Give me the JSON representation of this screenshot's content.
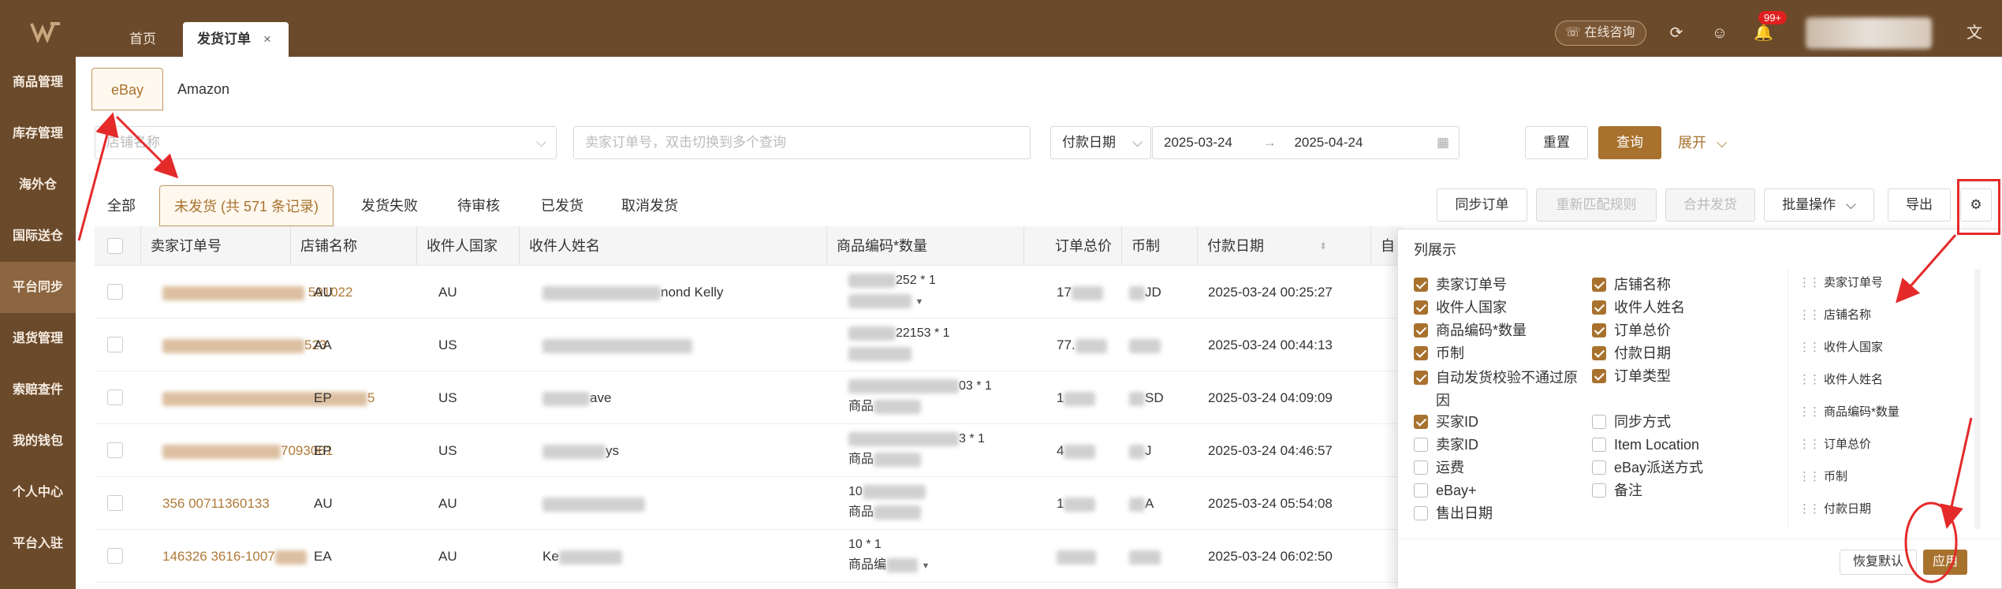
{
  "topbar": {
    "tabs": [
      {
        "label": "首页",
        "active": false
      },
      {
        "label": "发货订单",
        "active": true,
        "close": "×"
      }
    ],
    "consult_label": "在线咨询",
    "notification_count": "99+",
    "accent_color": "#6b4a2b"
  },
  "sidebar": {
    "items": [
      {
        "label": "商品管理"
      },
      {
        "label": "库存管理"
      },
      {
        "label": "海外仓"
      },
      {
        "label": "国际送仓"
      },
      {
        "label": "平台同步",
        "active": true
      },
      {
        "label": "退货管理"
      },
      {
        "label": "索赔查件"
      },
      {
        "label": "我的钱包"
      },
      {
        "label": "个人中心"
      },
      {
        "label": "平台入驻"
      }
    ]
  },
  "platform_tabs": [
    {
      "label": "eBay",
      "active": true
    },
    {
      "label": "Amazon"
    }
  ],
  "filters": {
    "store_placeholder": "店铺名称",
    "order_placeholder": "卖家订单号，双击切换到多个查询",
    "date_type": "付款日期",
    "date_from": "2025-03-24",
    "date_sep": "→",
    "date_to": "2025-04-24",
    "reset": "重置",
    "search": "查询",
    "expand": "展开"
  },
  "status_tabs": [
    {
      "label": "全部"
    },
    {
      "label": "未发货 (共 571 条记录)",
      "active": true
    },
    {
      "label": "发货失败"
    },
    {
      "label": "待审核"
    },
    {
      "label": "已发货"
    },
    {
      "label": "取消发货"
    }
  ],
  "actions": {
    "sync": "同步订单",
    "rematch": "重新匹配规则",
    "merge": "合并发货",
    "batch": "批量操作",
    "export": "导出"
  },
  "table": {
    "columns": [
      "卖家订单号",
      "店铺名称",
      "收件人国家",
      "收件人姓名",
      "商品编码*数量",
      "订单总价",
      "币制",
      "付款日期",
      "自动"
    ],
    "rows": [
      {
        "order_tail": "591022",
        "store": "AU",
        "country": "AU",
        "name_tail": "nond Kelly",
        "sku_tail": "252 * 1",
        "price_head": "17",
        "currency_tail": "JD",
        "date": "2025-03-24 00:25:27"
      },
      {
        "order_tail": "523",
        "store": "AA",
        "country": "US",
        "name_tail": "",
        "sku_tail": "22153 * 1",
        "price_head": "77.",
        "currency_tail": "",
        "date": "2025-03-24 00:44:13"
      },
      {
        "order_tail": "5",
        "store": "EP",
        "country": "US",
        "name_tail": "ave",
        "sku_tail": "03 * 1",
        "price_head": "1",
        "currency_tail": "SD",
        "date": "2025-03-24 04:09:09"
      },
      {
        "order_tail": "7093061",
        "store": "EP",
        "country": "US",
        "name_tail": "ys",
        "sku_tail": "3 * 1",
        "price_head": "4",
        "currency_tail": "J",
        "date": "2025-03-24 04:46:57"
      },
      {
        "order_tail": "356            00711360133",
        "store": "AU",
        "country": "AU",
        "name_tail": "",
        "sku_tail": "10",
        "price_head": "1",
        "currency_tail": "A",
        "date": "2025-03-24 05:54:08"
      },
      {
        "order_tail": "146326   3616-1007",
        "store": "EA",
        "country": "AU",
        "name_tail": "Ke",
        "sku_tail": "10 * 1",
        "price_head": "",
        "currency_tail": "",
        "date": "2025-03-24 06:02:50"
      }
    ],
    "sku_second_line": "商品",
    "sku_second_line_b": "商品编"
  },
  "column_panel": {
    "title": "列展示",
    "options": [
      {
        "label": "卖家订单号",
        "checked": true
      },
      {
        "label": "店铺名称",
        "checked": true
      },
      {
        "label": "收件人国家",
        "checked": true
      },
      {
        "label": "收件人姓名",
        "checked": true
      },
      {
        "label": "商品编码*数量",
        "checked": true
      },
      {
        "label": "订单总价",
        "checked": true
      },
      {
        "label": "币制",
        "checked": true
      },
      {
        "label": "付款日期",
        "checked": true
      },
      {
        "label": "自动发货校验不通过原因",
        "checked": true
      },
      {
        "label": "订单类型",
        "checked": true
      },
      {
        "label": "买家ID",
        "checked": true
      },
      {
        "label": "同步方式",
        "checked": false
      },
      {
        "label": "卖家ID",
        "checked": false
      },
      {
        "label": "Item Location",
        "checked": false
      },
      {
        "label": "运费",
        "checked": false
      },
      {
        "label": "eBay派送方式",
        "checked": false
      },
      {
        "label": "eBay+",
        "checked": false
      },
      {
        "label": "备注",
        "checked": false
      },
      {
        "label": "售出日期",
        "checked": false
      }
    ],
    "order_list": [
      "卖家订单号",
      "店铺名称",
      "收件人国家",
      "收件人姓名",
      "商品编码*数量",
      "订单总价",
      "币制",
      "付款日期"
    ],
    "restore": "恢复默认",
    "apply": "应用"
  }
}
